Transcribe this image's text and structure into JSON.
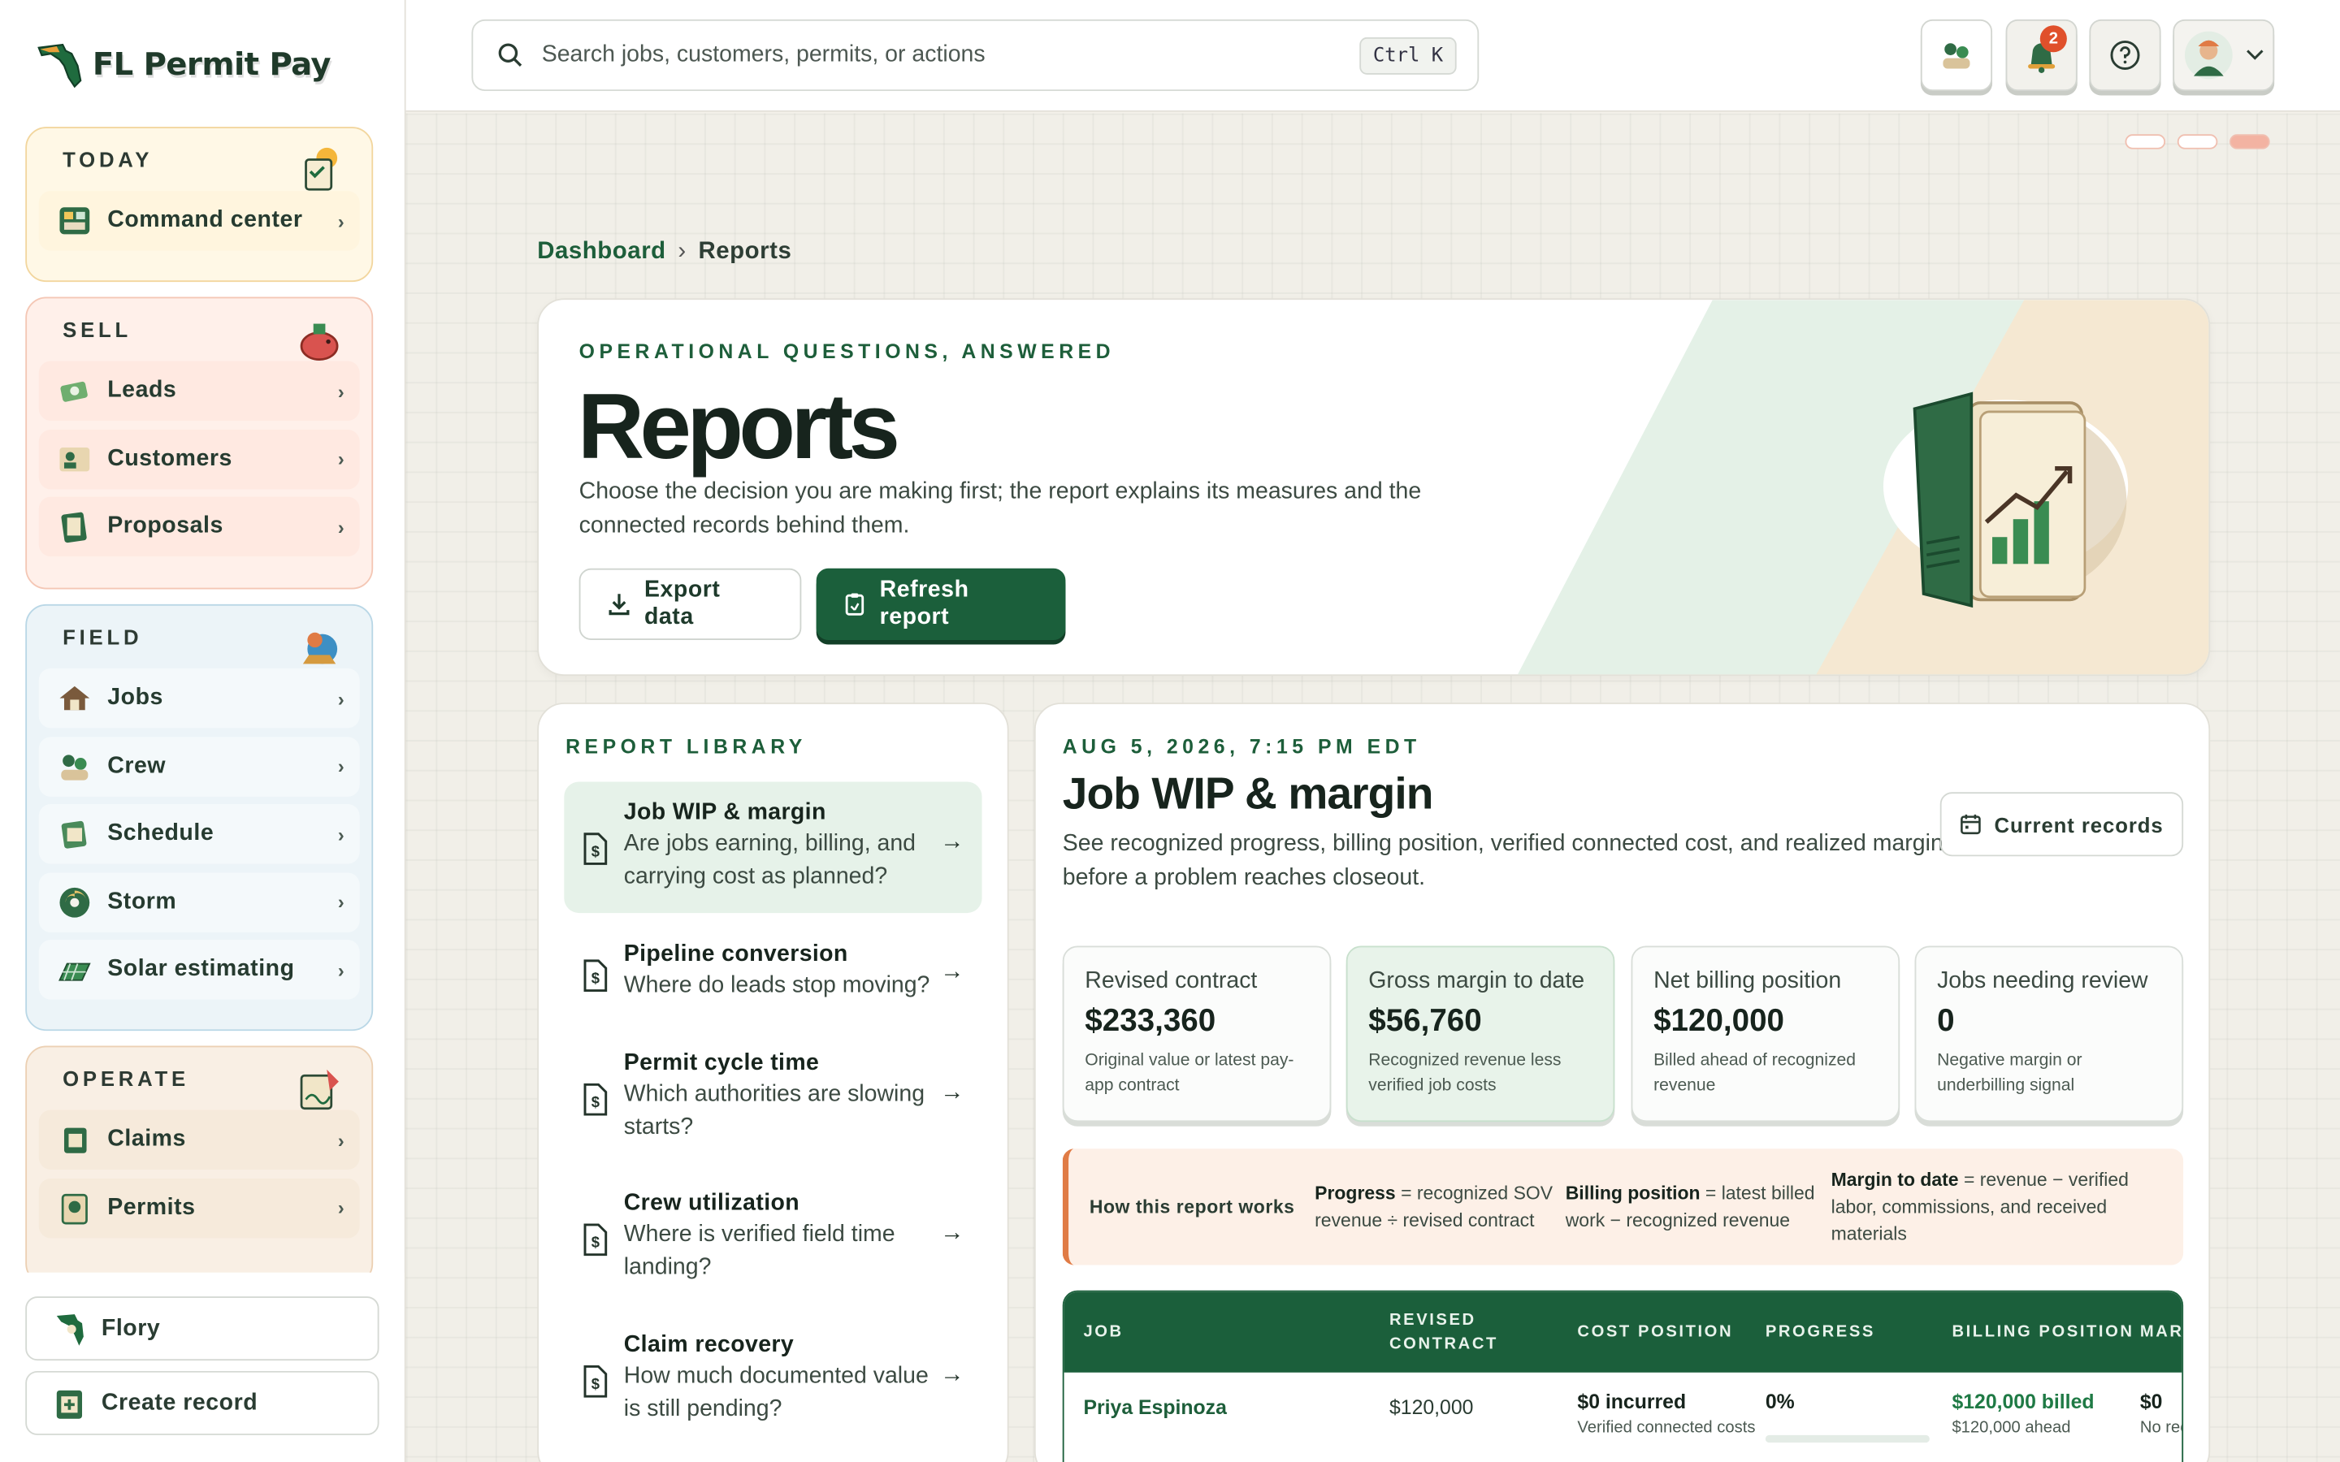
{
  "app": {
    "name": "FL Permit Pay"
  },
  "sidebar": {
    "today": {
      "title": "TODAY",
      "items": [
        {
          "label": "Command center"
        }
      ]
    },
    "sell": {
      "title": "SELL",
      "items": [
        {
          "label": "Leads"
        },
        {
          "label": "Customers"
        },
        {
          "label": "Proposals"
        }
      ]
    },
    "field": {
      "title": "FIELD",
      "items": [
        {
          "label": "Jobs"
        },
        {
          "label": "Crew"
        },
        {
          "label": "Schedule"
        },
        {
          "label": "Storm"
        },
        {
          "label": "Solar estimating"
        }
      ]
    },
    "operate": {
      "title": "OPERATE",
      "items": [
        {
          "label": "Claims"
        },
        {
          "label": "Permits"
        }
      ]
    },
    "footer": {
      "flory": "Flory",
      "create": "Create record"
    }
  },
  "topbar": {
    "search_placeholder": "Search jobs, customers, permits, or actions",
    "shortcut": "Ctrl K",
    "notifications_count": "2"
  },
  "breadcrumb": {
    "root": "Dashboard",
    "separator": "›",
    "current": "Reports"
  },
  "hero": {
    "eyebrow": "OPERATIONAL QUESTIONS, ANSWERED",
    "title": "Reports",
    "description": "Choose the decision you are making first; the report explains its measures and the connected records behind them.",
    "export_label": "Export data",
    "refresh_label": "Refresh report"
  },
  "library": {
    "title": "REPORT LIBRARY",
    "items": [
      {
        "title": "Job WIP & margin",
        "question": "Are jobs earning, billing, and carrying cost as planned?",
        "active": true
      },
      {
        "title": "Pipeline conversion",
        "question": "Where do leads stop moving?"
      },
      {
        "title": "Permit cycle time",
        "question": "Which authorities are slowing starts?"
      },
      {
        "title": "Crew utilization",
        "question": "Where is verified field time landing?"
      },
      {
        "title": "Claim recovery",
        "question": "How much documented value is still pending?"
      }
    ]
  },
  "report": {
    "timestamp": "AUG 5, 2026, 7:15 PM EDT",
    "title": "Job WIP & margin",
    "description": "See recognized progress, billing position, verified connected cost, and realized margin before a problem reaches closeout.",
    "current_label": "Current records",
    "kpis": [
      {
        "label": "Revised contract",
        "value": "$233,360",
        "sub": "Original value or latest pay-app contract"
      },
      {
        "label": "Gross margin to date",
        "value": "$56,760",
        "sub": "Recognized revenue less verified job costs"
      },
      {
        "label": "Net billing position",
        "value": "$120,000",
        "sub": "Billed ahead of recognized revenue"
      },
      {
        "label": "Jobs needing review",
        "value": "0",
        "sub": "Negative margin or underbilling signal"
      }
    ],
    "how": {
      "label": "How this report works",
      "progress_term": "Progress",
      "progress_def": " = recognized SOV revenue ÷ revised contract",
      "billing_term": "Billing position",
      "billing_def": " = latest billed work − recognized revenue",
      "margin_term": "Margin to date",
      "margin_def": " = revenue − verified labor, commissions, and received materials"
    },
    "table": {
      "columns": [
        "JOB",
        "REVISED CONTRACT",
        "COST POSITION",
        "PROGRESS",
        "BILLING POSITION",
        "MARGIN"
      ],
      "rows": [
        {
          "job": "Priya Espinoza",
          "contract": "$120,000",
          "cost": "$0 incurred",
          "cost_sub": "Verified connected costs",
          "progress": "0%",
          "progress_value": 0,
          "billing": "$120,000 billed",
          "billing_sub": "$120,000 ahead",
          "margin": "$0",
          "margin_sub": "No recognized revenue"
        }
      ]
    }
  },
  "colors": {
    "brand": "#1b5f3b",
    "accent": "#e07b45",
    "badge": "#e0502b"
  }
}
